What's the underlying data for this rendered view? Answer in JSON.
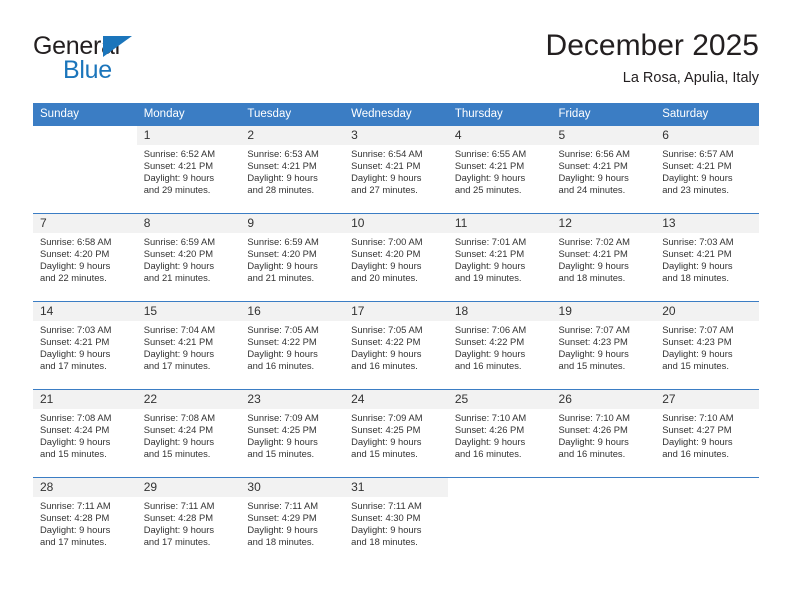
{
  "brand": {
    "name_part1": "General",
    "name_part2": "Blue",
    "triangle_icon": "triangle-icon",
    "accent_color": "#1b75bb",
    "text_color": "#231f20"
  },
  "header": {
    "title": "December 2025",
    "subtitle": "La Rosa, Apulia, Italy"
  },
  "theme": {
    "header_row_color": "#3b7dc4",
    "daynum_bg": "#f2f2f2",
    "body_text": "#333333",
    "page_bg": "#ffffff"
  },
  "weekday_headers": [
    "Sunday",
    "Monday",
    "Tuesday",
    "Wednesday",
    "Thursday",
    "Friday",
    "Saturday"
  ],
  "weeks": [
    [
      {
        "day": "",
        "sunrise": "",
        "sunset": "",
        "daylight_line1": "",
        "daylight_line2": "",
        "empty": true
      },
      {
        "day": "1",
        "sunrise": "Sunrise: 6:52 AM",
        "sunset": "Sunset: 4:21 PM",
        "daylight_line1": "Daylight: 9 hours",
        "daylight_line2": "and 29 minutes."
      },
      {
        "day": "2",
        "sunrise": "Sunrise: 6:53 AM",
        "sunset": "Sunset: 4:21 PM",
        "daylight_line1": "Daylight: 9 hours",
        "daylight_line2": "and 28 minutes."
      },
      {
        "day": "3",
        "sunrise": "Sunrise: 6:54 AM",
        "sunset": "Sunset: 4:21 PM",
        "daylight_line1": "Daylight: 9 hours",
        "daylight_line2": "and 27 minutes."
      },
      {
        "day": "4",
        "sunrise": "Sunrise: 6:55 AM",
        "sunset": "Sunset: 4:21 PM",
        "daylight_line1": "Daylight: 9 hours",
        "daylight_line2": "and 25 minutes."
      },
      {
        "day": "5",
        "sunrise": "Sunrise: 6:56 AM",
        "sunset": "Sunset: 4:21 PM",
        "daylight_line1": "Daylight: 9 hours",
        "daylight_line2": "and 24 minutes."
      },
      {
        "day": "6",
        "sunrise": "Sunrise: 6:57 AM",
        "sunset": "Sunset: 4:21 PM",
        "daylight_line1": "Daylight: 9 hours",
        "daylight_line2": "and 23 minutes."
      }
    ],
    [
      {
        "day": "7",
        "sunrise": "Sunrise: 6:58 AM",
        "sunset": "Sunset: 4:20 PM",
        "daylight_line1": "Daylight: 9 hours",
        "daylight_line2": "and 22 minutes."
      },
      {
        "day": "8",
        "sunrise": "Sunrise: 6:59 AM",
        "sunset": "Sunset: 4:20 PM",
        "daylight_line1": "Daylight: 9 hours",
        "daylight_line2": "and 21 minutes."
      },
      {
        "day": "9",
        "sunrise": "Sunrise: 6:59 AM",
        "sunset": "Sunset: 4:20 PM",
        "daylight_line1": "Daylight: 9 hours",
        "daylight_line2": "and 21 minutes."
      },
      {
        "day": "10",
        "sunrise": "Sunrise: 7:00 AM",
        "sunset": "Sunset: 4:20 PM",
        "daylight_line1": "Daylight: 9 hours",
        "daylight_line2": "and 20 minutes."
      },
      {
        "day": "11",
        "sunrise": "Sunrise: 7:01 AM",
        "sunset": "Sunset: 4:21 PM",
        "daylight_line1": "Daylight: 9 hours",
        "daylight_line2": "and 19 minutes."
      },
      {
        "day": "12",
        "sunrise": "Sunrise: 7:02 AM",
        "sunset": "Sunset: 4:21 PM",
        "daylight_line1": "Daylight: 9 hours",
        "daylight_line2": "and 18 minutes."
      },
      {
        "day": "13",
        "sunrise": "Sunrise: 7:03 AM",
        "sunset": "Sunset: 4:21 PM",
        "daylight_line1": "Daylight: 9 hours",
        "daylight_line2": "and 18 minutes."
      }
    ],
    [
      {
        "day": "14",
        "sunrise": "Sunrise: 7:03 AM",
        "sunset": "Sunset: 4:21 PM",
        "daylight_line1": "Daylight: 9 hours",
        "daylight_line2": "and 17 minutes."
      },
      {
        "day": "15",
        "sunrise": "Sunrise: 7:04 AM",
        "sunset": "Sunset: 4:21 PM",
        "daylight_line1": "Daylight: 9 hours",
        "daylight_line2": "and 17 minutes."
      },
      {
        "day": "16",
        "sunrise": "Sunrise: 7:05 AM",
        "sunset": "Sunset: 4:22 PM",
        "daylight_line1": "Daylight: 9 hours",
        "daylight_line2": "and 16 minutes."
      },
      {
        "day": "17",
        "sunrise": "Sunrise: 7:05 AM",
        "sunset": "Sunset: 4:22 PM",
        "daylight_line1": "Daylight: 9 hours",
        "daylight_line2": "and 16 minutes."
      },
      {
        "day": "18",
        "sunrise": "Sunrise: 7:06 AM",
        "sunset": "Sunset: 4:22 PM",
        "daylight_line1": "Daylight: 9 hours",
        "daylight_line2": "and 16 minutes."
      },
      {
        "day": "19",
        "sunrise": "Sunrise: 7:07 AM",
        "sunset": "Sunset: 4:23 PM",
        "daylight_line1": "Daylight: 9 hours",
        "daylight_line2": "and 15 minutes."
      },
      {
        "day": "20",
        "sunrise": "Sunrise: 7:07 AM",
        "sunset": "Sunset: 4:23 PM",
        "daylight_line1": "Daylight: 9 hours",
        "daylight_line2": "and 15 minutes."
      }
    ],
    [
      {
        "day": "21",
        "sunrise": "Sunrise: 7:08 AM",
        "sunset": "Sunset: 4:24 PM",
        "daylight_line1": "Daylight: 9 hours",
        "daylight_line2": "and 15 minutes."
      },
      {
        "day": "22",
        "sunrise": "Sunrise: 7:08 AM",
        "sunset": "Sunset: 4:24 PM",
        "daylight_line1": "Daylight: 9 hours",
        "daylight_line2": "and 15 minutes."
      },
      {
        "day": "23",
        "sunrise": "Sunrise: 7:09 AM",
        "sunset": "Sunset: 4:25 PM",
        "daylight_line1": "Daylight: 9 hours",
        "daylight_line2": "and 15 minutes."
      },
      {
        "day": "24",
        "sunrise": "Sunrise: 7:09 AM",
        "sunset": "Sunset: 4:25 PM",
        "daylight_line1": "Daylight: 9 hours",
        "daylight_line2": "and 15 minutes."
      },
      {
        "day": "25",
        "sunrise": "Sunrise: 7:10 AM",
        "sunset": "Sunset: 4:26 PM",
        "daylight_line1": "Daylight: 9 hours",
        "daylight_line2": "and 16 minutes."
      },
      {
        "day": "26",
        "sunrise": "Sunrise: 7:10 AM",
        "sunset": "Sunset: 4:26 PM",
        "daylight_line1": "Daylight: 9 hours",
        "daylight_line2": "and 16 minutes."
      },
      {
        "day": "27",
        "sunrise": "Sunrise: 7:10 AM",
        "sunset": "Sunset: 4:27 PM",
        "daylight_line1": "Daylight: 9 hours",
        "daylight_line2": "and 16 minutes."
      }
    ],
    [
      {
        "day": "28",
        "sunrise": "Sunrise: 7:11 AM",
        "sunset": "Sunset: 4:28 PM",
        "daylight_line1": "Daylight: 9 hours",
        "daylight_line2": "and 17 minutes."
      },
      {
        "day": "29",
        "sunrise": "Sunrise: 7:11 AM",
        "sunset": "Sunset: 4:28 PM",
        "daylight_line1": "Daylight: 9 hours",
        "daylight_line2": "and 17 minutes."
      },
      {
        "day": "30",
        "sunrise": "Sunrise: 7:11 AM",
        "sunset": "Sunset: 4:29 PM",
        "daylight_line1": "Daylight: 9 hours",
        "daylight_line2": "and 18 minutes."
      },
      {
        "day": "31",
        "sunrise": "Sunrise: 7:11 AM",
        "sunset": "Sunset: 4:30 PM",
        "daylight_line1": "Daylight: 9 hours",
        "daylight_line2": "and 18 minutes."
      },
      {
        "day": "",
        "sunrise": "",
        "sunset": "",
        "daylight_line1": "",
        "daylight_line2": "",
        "empty": true
      },
      {
        "day": "",
        "sunrise": "",
        "sunset": "",
        "daylight_line1": "",
        "daylight_line2": "",
        "empty": true
      },
      {
        "day": "",
        "sunrise": "",
        "sunset": "",
        "daylight_line1": "",
        "daylight_line2": "",
        "empty": true
      }
    ]
  ]
}
